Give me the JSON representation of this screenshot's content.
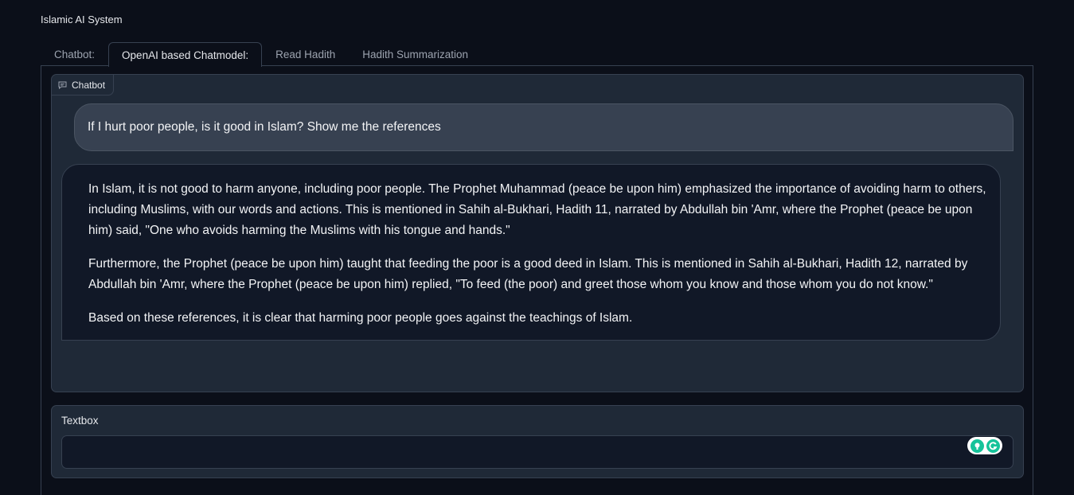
{
  "app": {
    "title": "Islamic AI System"
  },
  "tabs": [
    {
      "label": "Chatbot:"
    },
    {
      "label": "OpenAI based Chatmodel:"
    },
    {
      "label": "Read Hadith"
    },
    {
      "label": "Hadith Summarization"
    }
  ],
  "active_tab": "OpenAI based Chatmodel:",
  "chatbot": {
    "label": "Chatbot",
    "icon": "chat-bubble-icon",
    "messages": [
      {
        "role": "user",
        "text": "If I hurt poor people, is it good in Islam? Show me the references"
      },
      {
        "role": "bot",
        "paragraphs": [
          "In Islam, it is not good to harm anyone, including poor people. The Prophet Muhammad (peace be upon him) emphasized the importance of avoiding harm to others, including Muslims, with our words and actions. This is mentioned in Sahih al-Bukhari, Hadith 11, narrated by Abdullah bin 'Amr, where the Prophet (peace be upon him) said, \"One who avoids harming the Muslims with his tongue and hands.\"",
          "Furthermore, the Prophet (peace be upon him) taught that feeding the poor is a good deed in Islam. This is mentioned in Sahih al-Bukhari, Hadith 12, narrated by Abdullah bin 'Amr, where the Prophet (peace be upon him) replied, \"To feed (the poor) and greet those whom you know and those whom you do not know.\"",
          "Based on these references, it is clear that harming poor people goes against the teachings of Islam."
        ]
      }
    ]
  },
  "textbox": {
    "label": "Textbox",
    "value": "",
    "placeholder": ""
  },
  "colors": {
    "background": "#0b0f19",
    "panel": "#1f2937",
    "user_bubble": "#374151",
    "bot_bubble": "#111827",
    "border": "#374151",
    "grammarly_green": "#15c39a"
  }
}
